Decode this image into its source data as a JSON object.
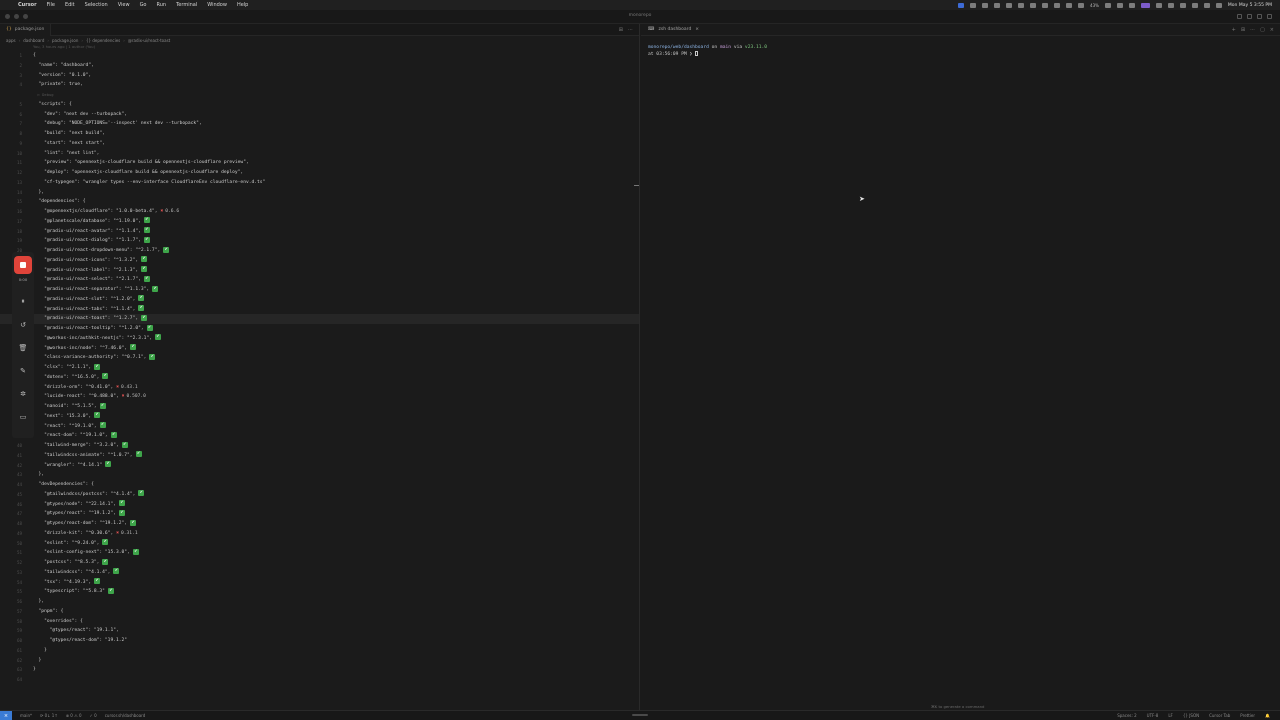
{
  "menubar": {
    "apple": "",
    "app": "Cursor",
    "items": [
      "File",
      "Edit",
      "Selection",
      "View",
      "Go",
      "Run",
      "Terminal",
      "Window",
      "Help"
    ],
    "battery": "43%",
    "clock": "Mon May 5 3:55 PM"
  },
  "window": {
    "title": "monorepo"
  },
  "editor": {
    "tab_label": "package.json",
    "breadcrumb": [
      "apps",
      "dashboard",
      "package.json",
      "{} dependencies",
      "@radix-ui/react-toast"
    ],
    "blame_hint": "You, 3 hours ago | 1 author (You)",
    "lines": [
      {
        "n": "1",
        "t": "{"
      },
      {
        "n": "2",
        "t": "  \"name\": \"dashboard\","
      },
      {
        "n": "3",
        "t": "  \"version\": \"0.1.0\","
      },
      {
        "n": "4",
        "t": "  \"private\": true,"
      },
      {
        "n": "",
        "t": "  ▷ Debug"
      },
      {
        "n": "5",
        "t": "  \"scripts\": {"
      },
      {
        "n": "6",
        "t": "    \"dev\": \"next dev --turbopack\","
      },
      {
        "n": "7",
        "t": "    \"debug\": \"NODE_OPTIONS='--inspect' next dev --turbopack\","
      },
      {
        "n": "8",
        "t": "    \"build\": \"next build\","
      },
      {
        "n": "9",
        "t": "    \"start\": \"next start\","
      },
      {
        "n": "10",
        "t": "    \"lint\": \"next lint\","
      },
      {
        "n": "11",
        "t": "    \"preview\": \"opennextjs-cloudflare build && opennextjs-cloudflare preview\","
      },
      {
        "n": "12",
        "t": "    \"deploy\": \"opennextjs-cloudflare build && opennextjs-cloudflare deploy\","
      },
      {
        "n": "13",
        "t": "    \"cf-typegen\": \"wrangler types --env-interface CloudflareEnv cloudflare-env.d.ts\""
      },
      {
        "n": "14",
        "t": "  },"
      },
      {
        "n": "15",
        "t": "  \"dependencies\": {"
      },
      {
        "n": "16",
        "t": "    \"@opennextjs/cloudflare\": \"1.0.0-beta.4\",",
        "bad": "✖",
        "newv": "0.6.6"
      },
      {
        "n": "17",
        "t": "    \"@planetscale/database\": \"^1.19.0\",",
        "ok": "✔"
      },
      {
        "n": "18",
        "t": "    \"@radix-ui/react-avatar\": \"^1.1.4\",",
        "ok": "✔"
      },
      {
        "n": "19",
        "t": "    \"@radix-ui/react-dialog\": \"^1.1.7\",",
        "ok": "✔"
      },
      {
        "n": "20",
        "t": "    \"@radix-ui/react-dropdown-menu\": \"^2.1.7\",",
        "ok": "✔"
      },
      {
        "n": "21",
        "t": "    \"@radix-ui/react-icons\": \"^1.3.2\",",
        "ok": "✔"
      },
      {
        "n": "22",
        "t": "    \"@radix-ui/react-label\": \"^2.1.3\",",
        "ok": "✔"
      },
      {
        "n": "23",
        "t": "    \"@radix-ui/react-select\": \"^2.1.7\",",
        "ok": "✔"
      },
      {
        "n": "24",
        "t": "    \"@radix-ui/react-separator\": \"^1.1.3\",",
        "ok": "✔"
      },
      {
        "n": "25",
        "t": "    \"@radix-ui/react-slot\": \"^1.2.0\",",
        "ok": "✔"
      },
      {
        "n": "26",
        "t": "    \"@radix-ui/react-tabs\": \"^1.1.4\",",
        "ok": "✔"
      },
      {
        "n": "27",
        "t": "    \"@radix-ui/react-toast\": \"^1.2.7\",",
        "ok": "✔",
        "active": true
      },
      {
        "n": "28",
        "t": "    \"@radix-ui/react-tooltip\": \"^1.2.0\",",
        "ok": "✔"
      },
      {
        "n": "29",
        "t": "    \"@workos-inc/authkit-nextjs\": \"^2.3.1\",",
        "ok": "✔"
      },
      {
        "n": "30",
        "t": "    \"@workos-inc/node\": \"^7.46.0\",",
        "ok": "✔"
      },
      {
        "n": "31",
        "t": "    \"class-variance-authority\": \"^0.7.1\",",
        "ok": "✔"
      },
      {
        "n": "32",
        "t": "    \"clsx\": \"^2.1.1\",",
        "ok": "✔"
      },
      {
        "n": "33",
        "t": "    \"dotenv\": \"^16.5.0\",",
        "ok": "✔"
      },
      {
        "n": "34",
        "t": "    \"drizzle-orm\": \"^0.41.0\",",
        "bad": "✖",
        "newv": "0.43.1"
      },
      {
        "n": "35",
        "t": "    \"lucide-react\": \"^0.488.0\",",
        "bad": "✖",
        "newv": "0.507.0"
      },
      {
        "n": "36",
        "t": "    \"nanoid\": \"^5.1.5\",",
        "ok": "✔"
      },
      {
        "n": "37",
        "t": "    \"next\": \"15.3.0\",",
        "ok": "✔"
      },
      {
        "n": "38",
        "t": "    \"react\": \"^19.1.0\",",
        "ok": "✔"
      },
      {
        "n": "39",
        "t": "    \"react-dom\": \"^19.1.0\",",
        "ok": "✔"
      },
      {
        "n": "40",
        "t": "    \"tailwind-merge\": \"^3.2.0\",",
        "ok": "✔"
      },
      {
        "n": "41",
        "t": "    \"tailwindcss-animate\": \"^1.0.7\",",
        "ok": "✔"
      },
      {
        "n": "42",
        "t": "    \"wrangler\": \"^4.14.1\"",
        "ok": "✔"
      },
      {
        "n": "43",
        "t": "  },"
      },
      {
        "n": "44",
        "t": "  \"devDependencies\": {"
      },
      {
        "n": "45",
        "t": "    \"@tailwindcss/postcss\": \"^4.1.4\",",
        "ok": "✔"
      },
      {
        "n": "46",
        "t": "    \"@types/node\": \"^22.14.1\",",
        "ok": "✔"
      },
      {
        "n": "47",
        "t": "    \"@types/react\": \"^19.1.2\",",
        "ok": "✔"
      },
      {
        "n": "48",
        "t": "    \"@types/react-dom\": \"^19.1.2\",",
        "ok": "✔"
      },
      {
        "n": "49",
        "t": "    \"drizzle-kit\": \"^0.30.6\",",
        "bad": "✖",
        "newv": "0.31.1"
      },
      {
        "n": "50",
        "t": "    \"eslint\": \"^9.24.0\",",
        "ok": "✔"
      },
      {
        "n": "51",
        "t": "    \"eslint-config-next\": \"15.3.0\",",
        "ok": "✔"
      },
      {
        "n": "52",
        "t": "    \"postcss\": \"^8.5.3\",",
        "ok": "✔"
      },
      {
        "n": "53",
        "t": "    \"tailwindcss\": \"^4.1.4\",",
        "ok": "✔"
      },
      {
        "n": "54",
        "t": "    \"tsx\": \"^4.19.3\",",
        "ok": "✔"
      },
      {
        "n": "55",
        "t": "    \"typescript\": \"^5.8.3\"",
        "ok": "✔"
      },
      {
        "n": "56",
        "t": "  },"
      },
      {
        "n": "57",
        "t": "  \"pnpm\": {"
      },
      {
        "n": "58",
        "t": "    \"overrides\": {"
      },
      {
        "n": "59",
        "t": "      \"@types/react\": \"19.1.1\","
      },
      {
        "n": "60",
        "t": "      \"@types/react-dom\": \"19.1.2\""
      },
      {
        "n": "61",
        "t": "    }"
      },
      {
        "n": "62",
        "t": "  }"
      },
      {
        "n": "63",
        "t": "}"
      },
      {
        "n": "64",
        "t": ""
      }
    ]
  },
  "recorder": {
    "time": "0:00",
    "tools": [
      "⏸",
      "↺",
      "🗑",
      "✎",
      "✲",
      "▭"
    ]
  },
  "terminal": {
    "tab_label": "zsh  dashboard",
    "prompt_path": "monorepo/web/dashboard",
    "prompt_on": "on",
    "prompt_branch": "main",
    "prompt_via": "via",
    "prompt_node": "v23.11.0",
    "prompt_time": "at 03:56:09 PM",
    "prompt_symbol": "❯",
    "hint": "⌘K to generate a command"
  },
  "statusbar": {
    "remote": "⨯",
    "items": [
      "main*",
      "⟳ 0↓ 1↑",
      "⊗ 0 ⚠ 0",
      "✓ 0",
      "cursor.sh/dashboard",
      "Spaces: 2",
      "UTF-8",
      "LF",
      "{} JSON",
      "Cursor Tab",
      "Prettier"
    ]
  }
}
